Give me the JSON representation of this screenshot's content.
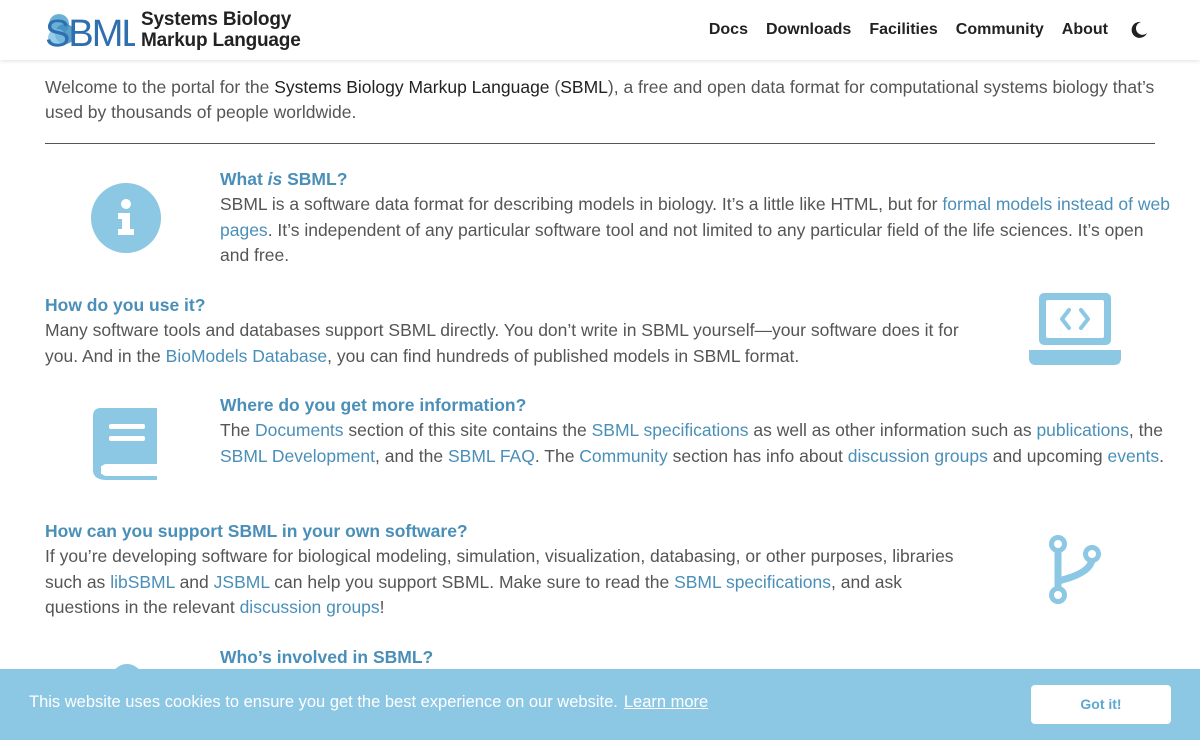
{
  "header": {
    "logo_mark": "SBML",
    "logo_line1": "Systems Biology",
    "logo_line2": "Markup Language",
    "nav": [
      "Docs",
      "Downloads",
      "Facilities",
      "Community",
      "About"
    ],
    "theme_icon": "moon-icon"
  },
  "intro": {
    "p1": "Welcome to the portal for the ",
    "strong1": "Systems Biology Markup Language",
    "p2": " (",
    "strong2": "SBML",
    "p3": "), a free and open data format for computational systems biology that’s used by thousands of people worldwide."
  },
  "sections": {
    "what": {
      "title_pre": "What ",
      "title_em": "is",
      "title_post": " SBML?",
      "t1": "SBML is a software data format for describing models in biology. It’s a little like HTML, but for ",
      "link1": "formal models instead of web pages",
      "t2": ". It’s independent of any particular software tool and not limited to any particular field of the life sciences. It’s open and free.",
      "icon": "info-icon"
    },
    "how": {
      "title": "How do you use it?",
      "t1": "Many software tools and databases support SBML directly. You don’t write in SBML yourself—your software does it for you. And in the ",
      "link1": "BioModels Database",
      "t2": ", you can find hundreds of published models in SBML format.",
      "icon": "laptop-code-icon"
    },
    "where": {
      "title": "Where do you get more information?",
      "t1": "The ",
      "link1": "Documents",
      "t2": " section of this site contains the ",
      "link2": "SBML specifications",
      "t3": " as well as other information such as ",
      "link3": "publications",
      "t4": ", the ",
      "link4": "SBML Development",
      "t5": ", and the ",
      "link5": "SBML FAQ",
      "t6": ". The ",
      "link6": "Community",
      "t7": " section has info about ",
      "link7": "discussion groups",
      "t8": " and upcoming ",
      "link8": "events",
      "t9": ".",
      "icon": "book-icon"
    },
    "support": {
      "title": "How can you support SBML in your own software?",
      "t1": "If you’re developing software for biological modeling, simulation, visualization, databasing, or other purposes, libraries such as ",
      "link1": "libSBML",
      "t2": " and ",
      "link2": "JSBML",
      "t3": " can help you support SBML. Make sure to read the ",
      "link3": "SBML specifications",
      "t4": ", and ask questions in the relevant ",
      "link4": "discussion groups",
      "t5": "!",
      "icon": "code-branch-icon"
    },
    "who": {
      "title": "Who’s involved in SBML?",
      "icon": "people-icon"
    }
  },
  "cookie": {
    "message": "This website uses cookies to ensure you get the best experience on our website.",
    "learn_more": "Learn more",
    "button": "Got it!"
  },
  "colors": {
    "accent": "#4a8fb8",
    "icon_blue": "#8cc7e4",
    "cookie_bg": "#8cc7e4"
  }
}
